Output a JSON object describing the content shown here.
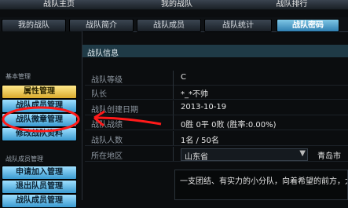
{
  "top_tabs": [
    "战队主页",
    "我的战队",
    "战队排行"
  ],
  "sub_tabs": [
    "我的战队",
    "战队简介",
    "战队成员",
    "战队统计",
    "战队密码"
  ],
  "sidebar": {
    "section1_label": "基本管理",
    "buttons1": [
      "属性管理",
      "战队成员管理",
      "战队微章管理",
      "修改战队资料"
    ],
    "section2_label": "战队成员管理",
    "buttons2": [
      "申请加入管理",
      "退出队员管理",
      "战队成员管理"
    ]
  },
  "main": {
    "header_title": "战队信息",
    "rows": [
      {
        "label": "战队等级",
        "value": "C"
      },
      {
        "label": "队长",
        "value": "*_*不帅"
      },
      {
        "label": "战队创建日期",
        "value": "2013-10-19"
      },
      {
        "label": "战队战绩",
        "value": "0胜 0平 0败 (胜率:0.00%)"
      },
      {
        "label": "战队人数",
        "value": "1名 / 50名"
      },
      {
        "label": "所在地区",
        "province": "山东省",
        "city": "青岛市"
      }
    ],
    "announcement": "一支团结、有实力的小分队，向着希望的前方，大"
  },
  "colors": {
    "annotation": "#ff1a1a",
    "active_tab": "#4aa3d0",
    "gold": "#e8c34a"
  }
}
